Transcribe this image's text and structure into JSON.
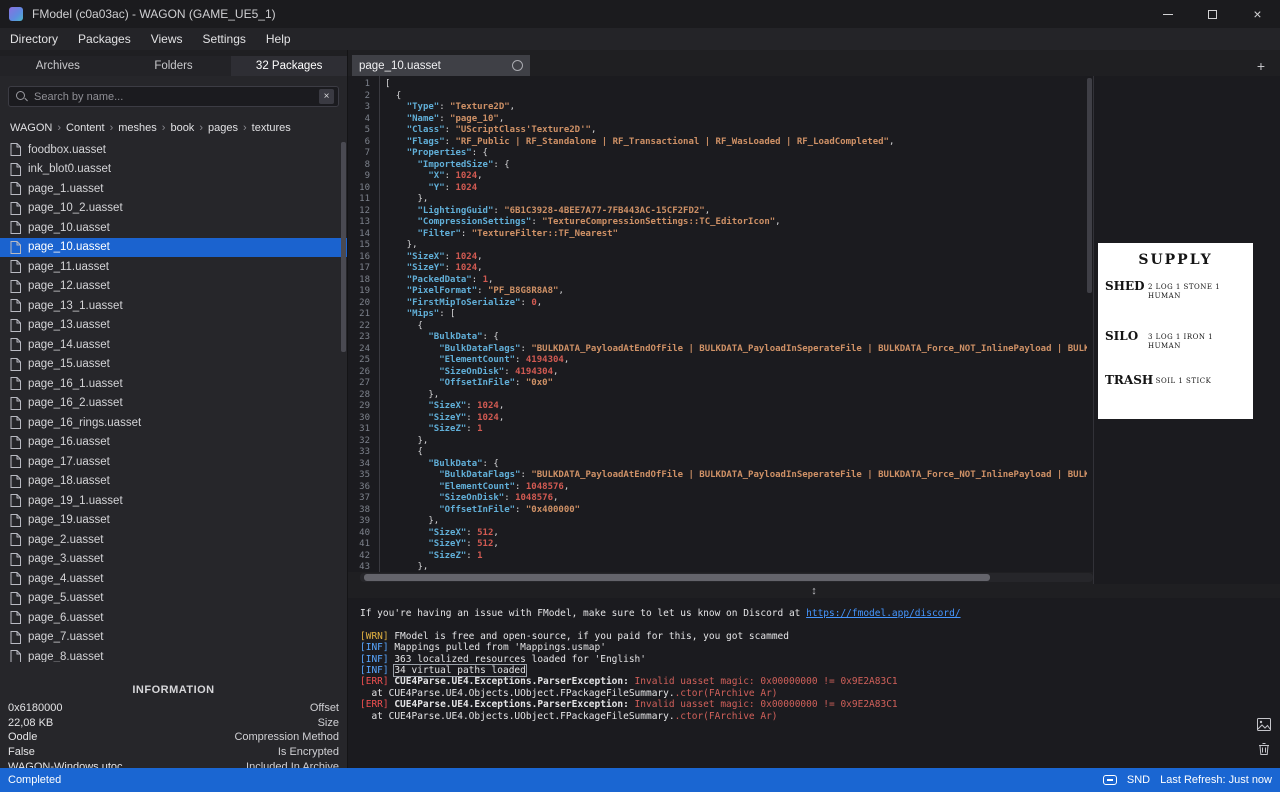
{
  "colors": {
    "accent_blue": "#1b63cf",
    "statusbar_blue": "#1a66d2",
    "editor_bg": "#1b1b1f",
    "panel_bg": "#26262a",
    "json_key": "#61afd8",
    "json_string": "#cf9166",
    "json_number": "#d25a52",
    "log_warning": "#e3b341",
    "log_info": "#58a6ff",
    "log_error": "#f05050",
    "log_link": "#4596ff"
  },
  "icons": {
    "close": "×",
    "clear_search": "×",
    "new_tab": "+",
    "splitter": "↕",
    "breadcrumb_separator": "›"
  },
  "titlebar": {
    "title": "FModel (c0a03ac) - WAGON (GAME_UE5_1)"
  },
  "menubar": {
    "items": [
      "Directory",
      "Packages",
      "Views",
      "Settings",
      "Help"
    ]
  },
  "sidebar": {
    "tabs": [
      {
        "label": "Archives",
        "active": false
      },
      {
        "label": "Folders",
        "active": false
      },
      {
        "label": "32 Packages",
        "active": true
      }
    ],
    "search": {
      "placeholder": "Search by name..."
    },
    "breadcrumb": [
      "WAGON",
      "Content",
      "meshes",
      "book",
      "pages",
      "textures"
    ],
    "files": [
      "foodbox.uasset",
      "ink_blot0.uasset",
      "page_1.uasset",
      "page_10_2.uasset",
      "page_10.uasset",
      "page_10.uasset",
      "page_11.uasset",
      "page_12.uasset",
      "page_13_1.uasset",
      "page_13.uasset",
      "page_14.uasset",
      "page_15.uasset",
      "page_16_1.uasset",
      "page_16_2.uasset",
      "page_16_rings.uasset",
      "page_16.uasset",
      "page_17.uasset",
      "page_18.uasset",
      "page_19_1.uasset",
      "page_19.uasset",
      "page_2.uasset",
      "page_3.uasset",
      "page_4.uasset",
      "page_5.uasset",
      "page_6.uasset",
      "page_7.uasset",
      "page_8.uasset"
    ],
    "selected_index": 5,
    "information": {
      "title": "INFORMATION",
      "rows": [
        {
          "value": "0x6180000",
          "label": "Offset"
        },
        {
          "value": "22,08 KB",
          "label": "Size"
        },
        {
          "value": "Oodle",
          "label": "Compression Method"
        },
        {
          "value": "False",
          "label": "Is Encrypted"
        },
        {
          "value": "WAGON-Windows.utoc",
          "label": "Included In Archive"
        }
      ]
    }
  },
  "editor": {
    "tab_label": "page_10.uasset",
    "code_lines": [
      "[",
      "  {",
      "    \"Type\": \"Texture2D\",",
      "    \"Name\": \"page_10\",",
      "    \"Class\": \"UScriptClass'Texture2D'\",",
      "    \"Flags\": \"RF_Public | RF_Standalone | RF_Transactional | RF_WasLoaded | RF_LoadCompleted\",",
      "    \"Properties\": {",
      "      \"ImportedSize\": {",
      "        \"X\": 1024,",
      "        \"Y\": 1024",
      "      },",
      "      \"LightingGuid\": \"6B1C3928-4BEE7A77-7FB443AC-15CF2FD2\",",
      "      \"CompressionSettings\": \"TextureCompressionSettings::TC_EditorIcon\",",
      "      \"Filter\": \"TextureFilter::TF_Nearest\"",
      "    },",
      "    \"SizeX\": 1024,",
      "    \"SizeY\": 1024,",
      "    \"PackedData\": 1,",
      "    \"PixelFormat\": \"PF_B8G8R8A8\",",
      "    \"FirstMipToSerialize\": 0,",
      "    \"Mips\": [",
      "      {",
      "        \"BulkData\": {",
      "          \"BulkDataFlags\": \"BULKDATA_PayloadAtEndOfFile | BULKDATA_PayloadInSeperateFile | BULKDATA_Force_NOT_InlinePayload | BULKDA",
      "          \"ElementCount\": 4194304,",
      "          \"SizeOnDisk\": 4194304,",
      "          \"OffsetInFile\": \"0x0\"",
      "        },",
      "        \"SizeX\": 1024,",
      "        \"SizeY\": 1024,",
      "        \"SizeZ\": 1",
      "      },",
      "      {",
      "        \"BulkData\": {",
      "          \"BulkDataFlags\": \"BULKDATA_PayloadAtEndOfFile | BULKDATA_PayloadInSeperateFile | BULKDATA_Force_NOT_InlinePayload | BULKDA",
      "          \"ElementCount\": 1048576,",
      "          \"SizeOnDisk\": 1048576,",
      "          \"OffsetInFile\": \"0x400000\"",
      "        },",
      "        \"SizeX\": 512,",
      "        \"SizeY\": 512,",
      "        \"SizeZ\": 1",
      "      },"
    ]
  },
  "preview": {
    "title": "SUPPLY",
    "groups": [
      {
        "label": "SHED",
        "items": "2 LOG   1 STONE   1 HUMAN"
      },
      {
        "label": "SILO",
        "items": "3 LOG   1 IRON   1 HUMAN"
      },
      {
        "label": "TRASH",
        "items": "1 SOIL   1 STICK"
      }
    ]
  },
  "log": {
    "lines": [
      [
        {
          "t": "If you're having an issue with FModel, make sure to let us know on Discord at ",
          "c": "plain"
        },
        {
          "t": "https://fmodel.app/discord/",
          "c": "link"
        }
      ],
      [],
      [
        {
          "t": "[WRN] ",
          "c": "wrn"
        },
        {
          "t": "FModel is free and open-source, if you paid for this, you got scammed",
          "c": "plain"
        }
      ],
      [
        {
          "t": "[INF] ",
          "c": "inf"
        },
        {
          "t": "Mappings pulled from 'Mappings.usmap'",
          "c": "plain"
        }
      ],
      [
        {
          "t": "[INF] ",
          "c": "inf"
        },
        {
          "t": "363 localized resources loaded for 'English'",
          "c": "plain"
        }
      ],
      [
        {
          "t": "[INF] ",
          "c": "inf"
        },
        {
          "t": "34 virtual paths loaded",
          "c": "boxed"
        }
      ],
      [
        {
          "t": "[ERR] ",
          "c": "err"
        },
        {
          "t": "CUE4Parse.UE4.Exceptions.ParserException: ",
          "c": "bold"
        },
        {
          "t": "Invalid uasset magic: 0x00000000 != 0x9E2A83C1",
          "c": "errmsg"
        }
      ],
      [
        {
          "t": "  at CUE4Parse.UE4.Objects.UObject.FPackageFileSummary.",
          "c": "plain"
        },
        {
          "t": ".ctor(FArchive Ar)",
          "c": "errmsg"
        }
      ],
      [
        {
          "t": "[ERR] ",
          "c": "err"
        },
        {
          "t": "CUE4Parse.UE4.Exceptions.ParserException: ",
          "c": "bold"
        },
        {
          "t": "Invalid uasset magic: 0x00000000 != 0x9E2A83C1",
          "c": "errmsg"
        }
      ],
      [
        {
          "t": "  at CUE4Parse.UE4.Objects.UObject.FPackageFileSummary.",
          "c": "plain"
        },
        {
          "t": ".ctor(FArchive Ar)",
          "c": "errmsg"
        }
      ]
    ]
  },
  "statusbar": {
    "status": "Completed",
    "snd": "SND",
    "last_refresh": "Last Refresh: Just now"
  }
}
